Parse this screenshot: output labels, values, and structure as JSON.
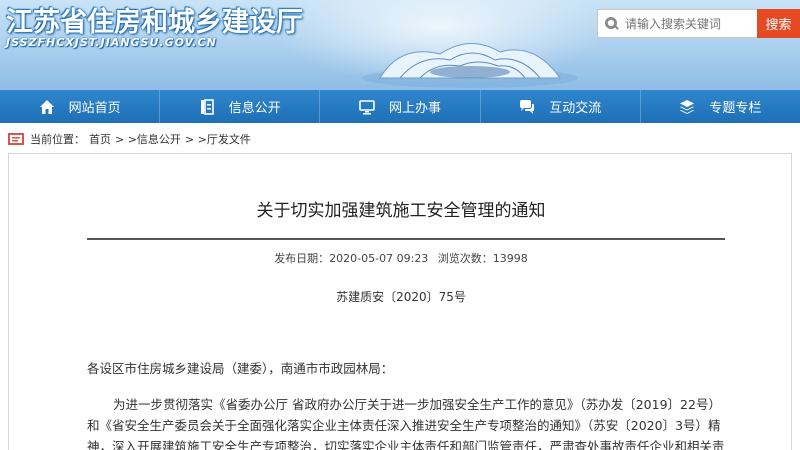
{
  "header": {
    "site_title": "江苏省住房和城乡建设厅",
    "site_url": "JSSZFHCXJST.JIANGSU.GOV.CN",
    "search_placeholder": "请输入搜索关键词",
    "search_button": "搜索"
  },
  "nav": {
    "items": [
      {
        "label": "网站首页",
        "icon": "home-icon"
      },
      {
        "label": "信息公开",
        "icon": "document-icon"
      },
      {
        "label": "网上办事",
        "icon": "monitor-icon"
      },
      {
        "label": "互动交流",
        "icon": "chat-icon"
      },
      {
        "label": "专题专栏",
        "icon": "layers-icon"
      }
    ]
  },
  "breadcrumb": {
    "prefix": "当前位置：",
    "items": [
      "首页",
      "> >信息公开",
      "> >厅发文件"
    ]
  },
  "article": {
    "title": "关于切实加强建筑施工安全管理的通知",
    "publish_date_label": "发布日期：2020-05-07 09:23",
    "views_label": "浏览次数：13998",
    "doc_number": "苏建质安〔2020〕75号",
    "recipients": "各设区市住房城乡建设局（建委），南通市市政园林局：",
    "body_line1": "为进一步贯彻落实《省委办公厅 省政府办公厅关于进一步加强安全生产工作的意见》（苏办发〔2019〕22号）",
    "body_line2": "和《省安全生产委员会关于全面强化落实企业主体责任深入推进安全生产专项整治的通知》（苏安〔2020〕3号）精",
    "body_line3": "神，深入开展建筑施工安全生产专项整治，切实落实企业主体责任和部门监管责任，严肃查处事故责任企业和相关责"
  },
  "colors": {
    "nav_bg": "#2573bd",
    "search_button": "#e64a24",
    "title_text": "#ffffff"
  }
}
